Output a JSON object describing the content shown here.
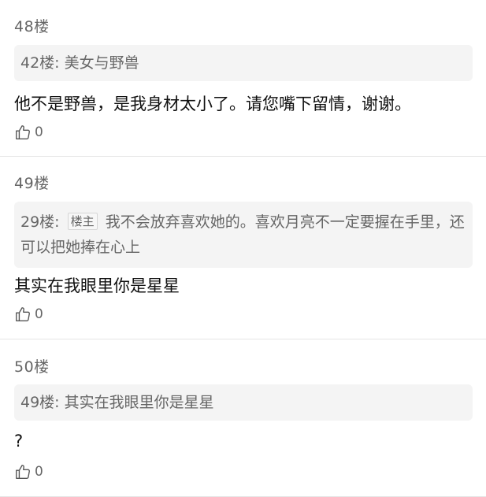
{
  "comments": [
    {
      "floor": "48楼",
      "quote_prefix": "42楼:",
      "quote_text": "美女与野兽",
      "body": "他不是野兽，是我身材太小了。请您嘴下留情，谢谢。",
      "likes": "0"
    },
    {
      "floor": "49楼",
      "quote_prefix": "29楼:",
      "quote_badge": "楼主",
      "quote_text": "我不会放弃喜欢她的。喜欢月亮不一定要握在手里，还可以把她捧在心上",
      "body": "其实在我眼里你是星星",
      "likes": "0"
    },
    {
      "floor": "50楼",
      "quote_prefix": "49楼:",
      "quote_text": "其实在我眼里你是星星",
      "body": "?",
      "likes": "0"
    }
  ],
  "icons": {
    "like": "thumbs-up-icon"
  },
  "colors": {
    "quote_bg": "#f4f4f4",
    "muted_text": "#666666",
    "divider": "#e6e6e6"
  }
}
